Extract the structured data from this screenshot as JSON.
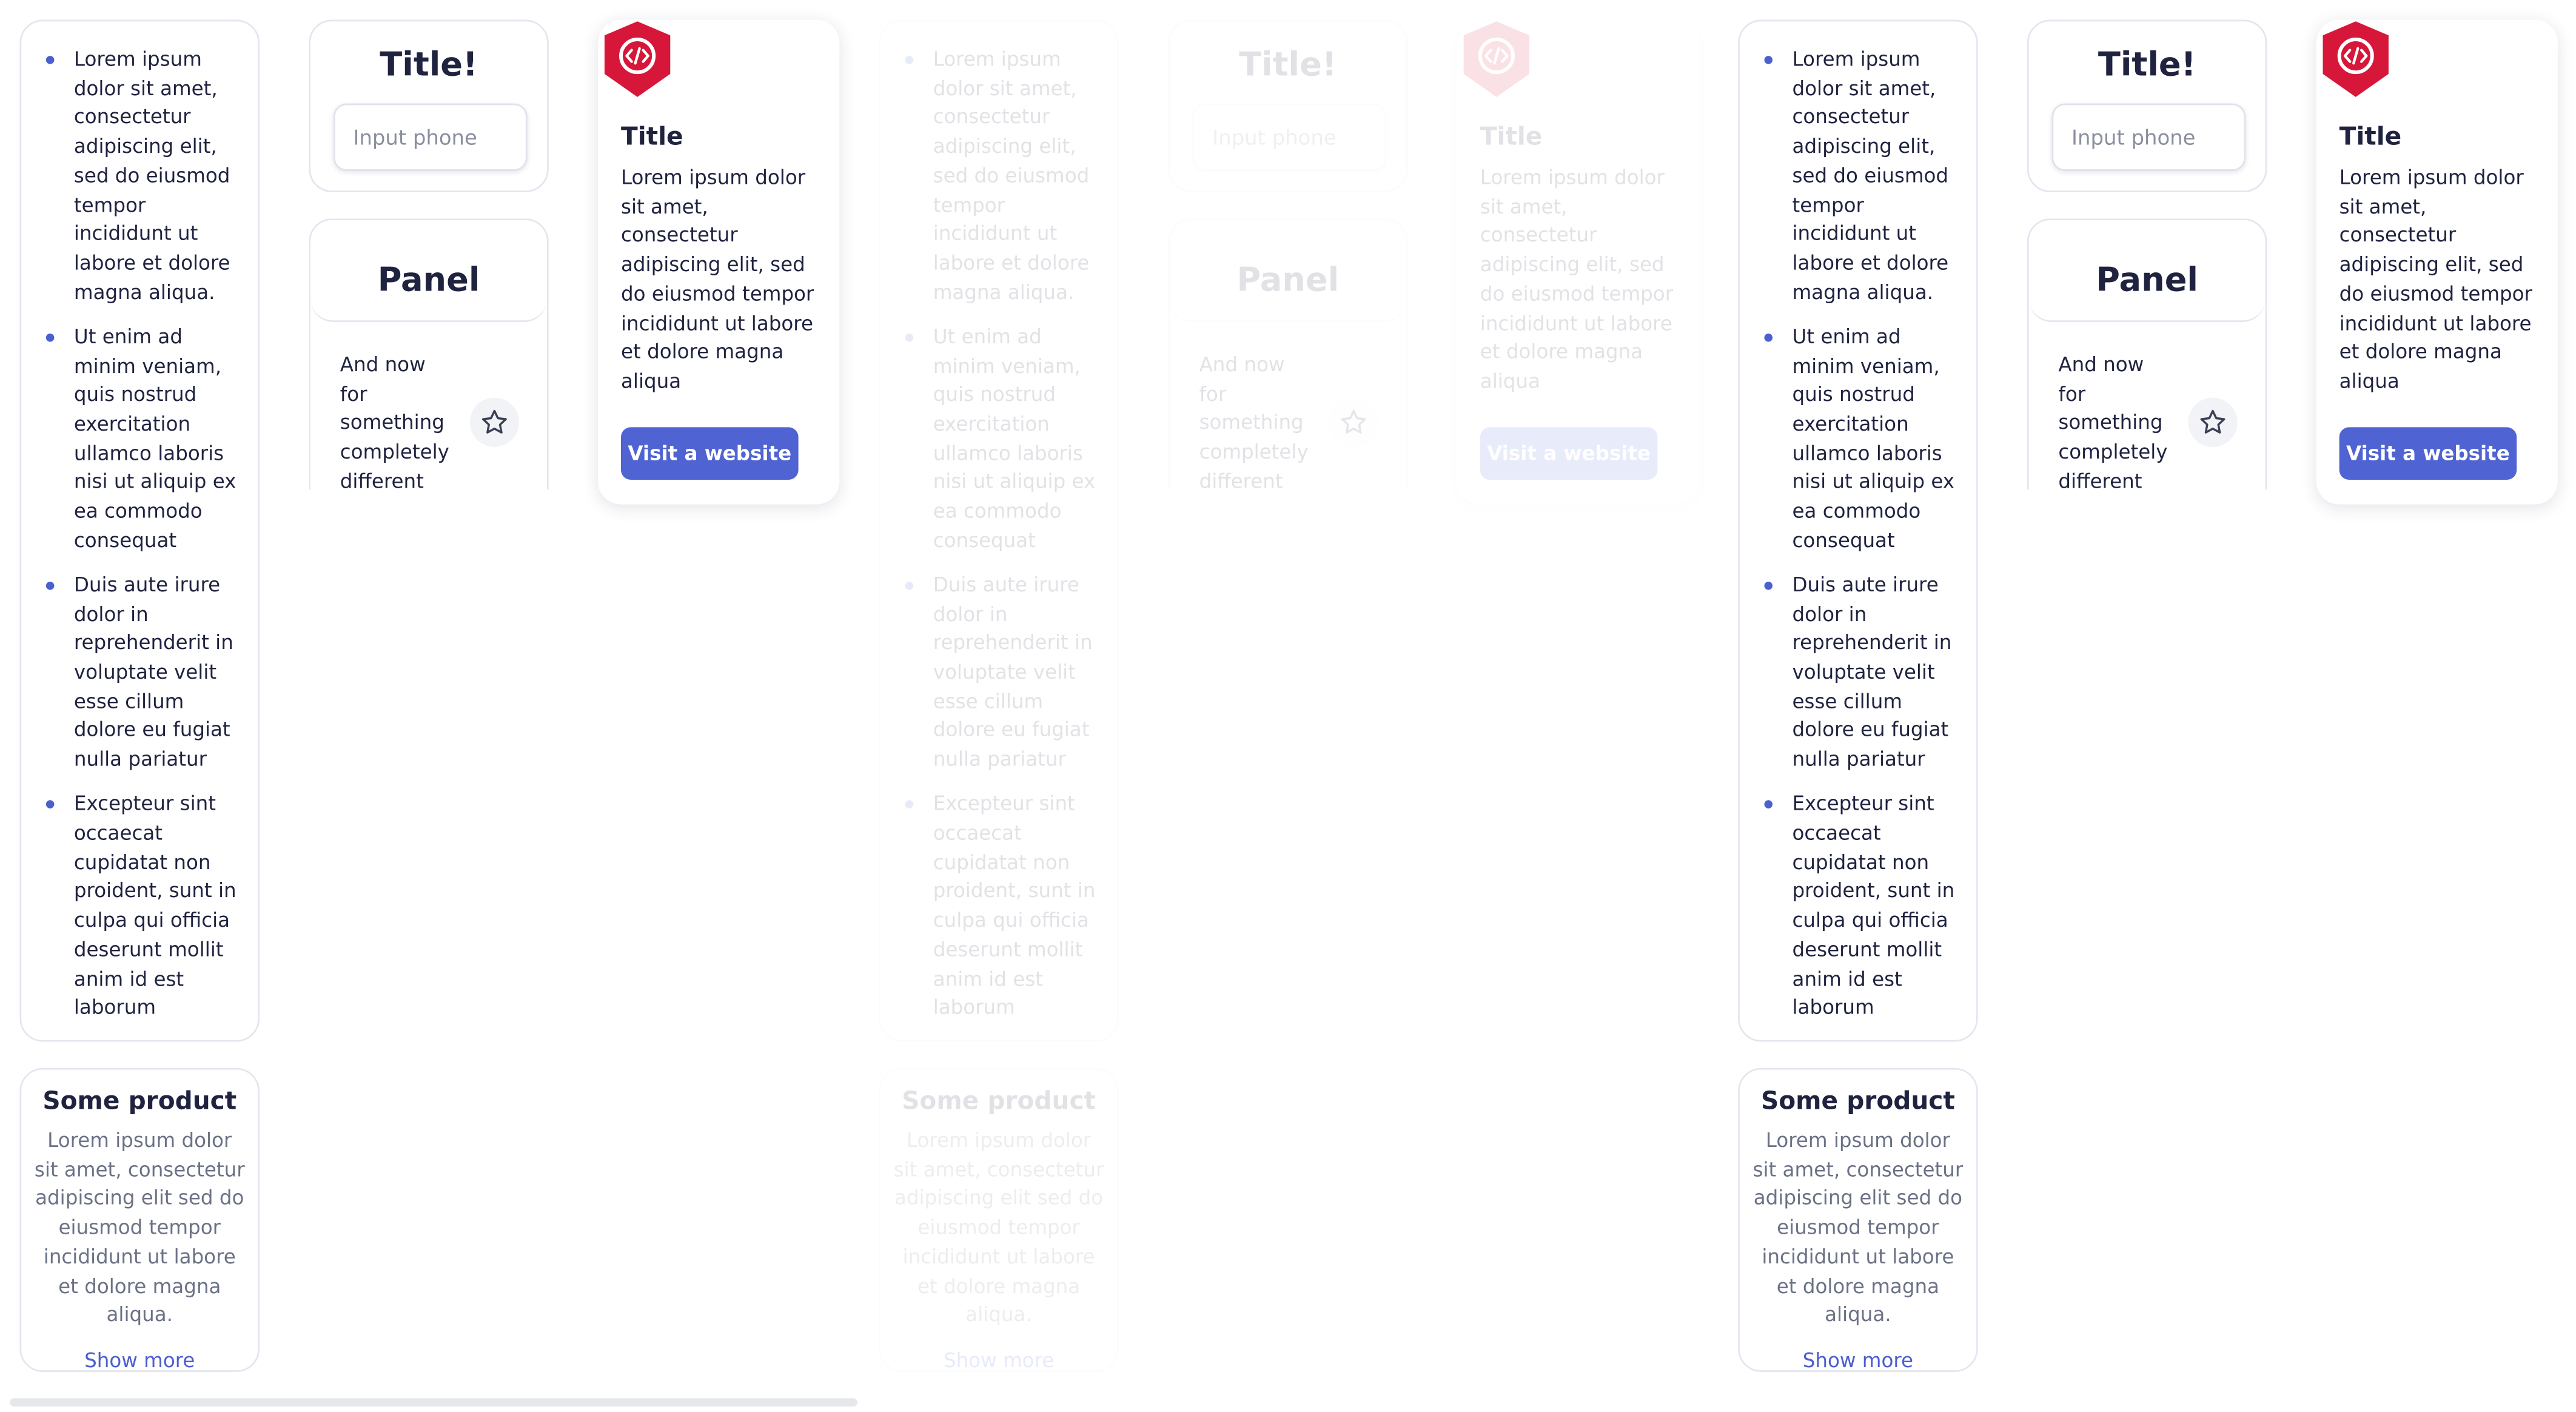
{
  "list_items": [
    "Lorem ipsum dolor sit amet, consectetur adipiscing elit, sed do eiusmod tempor incididunt ut labore et dolore magna aliqua.",
    "Ut enim ad minim veniam, quis nostrud exercitation ullamco laboris nisi ut aliquip ex ea commodo consequat",
    "Duis aute irure dolor in reprehenderit in voluptate velit esse cillum dolore eu fugiat nulla pariatur",
    "Excepteur sint occaecat cupidatat non proident, sunt in culpa qui officia deserunt mollit anim id est laborum"
  ],
  "product": {
    "title": "Some product",
    "text": "Lorem ipsum dolor sit amet, consectetur adipiscing elit sed do eiusmod tempor incididunt ut labore et dolore magna aliqua.",
    "link": "Show more"
  },
  "title_card": {
    "title": "Title!",
    "input_placeholder": "Input phone"
  },
  "panel": {
    "title": "Panel",
    "text": "And now for something completely different",
    "star_icon": "star-icon"
  },
  "info_card": {
    "logo_icon": "code-shield-icon",
    "title": "Title",
    "text": "Lorem ipsum dolor sit amet, consectetur adipiscing elit, sed do eiusmod tempor incididunt ut labore et dolore magna aliqua",
    "button": "Visit a website"
  },
  "colors": {
    "accent": "#4f63d2",
    "bullet": "#4b5fcf",
    "logo": "#d6173a",
    "text": "#1f2340",
    "muted": "#6b7286"
  }
}
